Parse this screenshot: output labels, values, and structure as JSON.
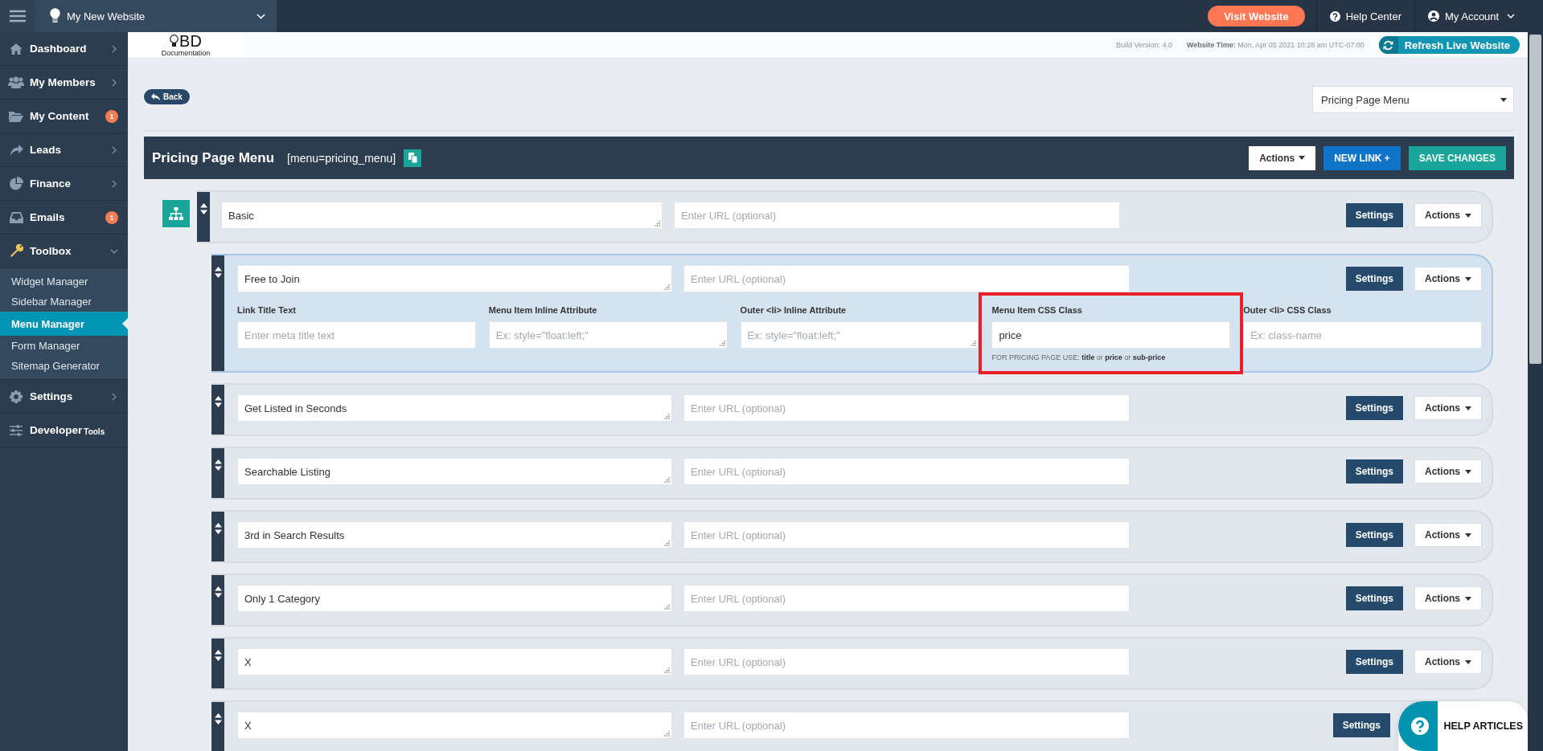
{
  "topbar": {
    "site": "My New Website",
    "visit_button": "Visit Website",
    "help": "Help Center",
    "account": "My Account"
  },
  "sidebar": {
    "items": [
      {
        "label": "Dashboard",
        "expanded": false
      },
      {
        "label": "My Members",
        "expanded": false
      },
      {
        "label": "My Content",
        "badge": "1"
      },
      {
        "label": "Leads",
        "expanded": false
      },
      {
        "label": "Finance",
        "expanded": false
      },
      {
        "label": "Emails",
        "badge": "1"
      },
      {
        "label": "Toolbox",
        "expanded": true,
        "children": [
          {
            "label": "Widget Manager",
            "selected": false
          },
          {
            "label": "Sidebar Manager",
            "selected": false
          },
          {
            "label": "Menu Manager",
            "selected": true
          },
          {
            "label": "Form Manager",
            "selected": false
          },
          {
            "label": "Sitemap Generator",
            "selected": false
          }
        ]
      },
      {
        "label": "Settings",
        "expanded": false
      },
      {
        "label": "Developer",
        "label_small": "Tools"
      }
    ]
  },
  "subheader": {
    "logo_title": "BD",
    "logo_subtitle": "Documentation",
    "build": "Build Version: 4.0",
    "time": "**Website Time:** Mon, Apr 05 2021 10:28 am UTC-07:00",
    "refresh_button": "Refresh Live Website"
  },
  "back_button": "Back",
  "menu_select": "Pricing Page Menu",
  "panel": {
    "title": "Pricing Page Menu",
    "shortcode": "[menu=pricing_menu]",
    "buttons": [
      {
        "label": "Actions",
        "kind": "dropdown"
      },
      {
        "label": "NEW LINK +",
        "kind": "primary"
      },
      {
        "label": "SAVE CHANGES",
        "kind": "success"
      }
    ]
  },
  "items": [
    {
      "title": "Basic",
      "url_placeholder": "Enter URL (optional)",
      "buttons": [
        "Settings",
        "Actions"
      ],
      "expanded": false,
      "children": [
        {
          "title": "Free to Join",
          "url_placeholder": "Enter URL (optional)",
          "buttons": [
            "Settings",
            "Actions"
          ],
          "expanded": true,
          "details": [
            {
              "label": "Link Title Text",
              "placeholder": "Enter meta title text",
              "highlighted": false
            },
            {
              "label": "Menu Item Inline Attribute",
              "placeholder": "Ex: style=\"float:left;\"",
              "highlighted": false
            },
            {
              "label": "Outer <li> Inline Attribute",
              "placeholder": "Ex: style=\"float:left;\"",
              "highlighted": false
            },
            {
              "label": "Menu Item CSS Class",
              "value": "price",
              "hint": "FOR PRICING PAGE USE: **title** or **price** or **sub-price**",
              "highlighted": true
            },
            {
              "label": "Outer <li> CSS Class",
              "placeholder": "Ex: class-name",
              "highlighted": false
            }
          ]
        },
        {
          "title": "Get Listed in Seconds",
          "url_placeholder": "Enter URL (optional)",
          "buttons": [
            "Settings",
            "Actions"
          ],
          "expanded": false
        },
        {
          "title": "Searchable Listing",
          "url_placeholder": "Enter URL (optional)",
          "buttons": [
            "Settings",
            "Actions"
          ],
          "expanded": false
        },
        {
          "title": "3rd in Search Results",
          "url_placeholder": "Enter URL (optional)",
          "buttons": [
            "Settings",
            "Actions"
          ],
          "expanded": false
        },
        {
          "title": "Only 1 Category",
          "url_placeholder": "Enter URL (optional)",
          "buttons": [
            "Settings",
            "Actions"
          ],
          "expanded": false
        },
        {
          "title": "X",
          "url_placeholder": "Enter URL (optional)",
          "buttons": [
            "Settings",
            "Actions"
          ],
          "expanded": false
        },
        {
          "title": "X",
          "url_placeholder": "Enter URL (optional)",
          "buttons": [
            "Settings"
          ],
          "expanded": false
        }
      ]
    }
  ],
  "help_button": "HELP ARTICLES"
}
